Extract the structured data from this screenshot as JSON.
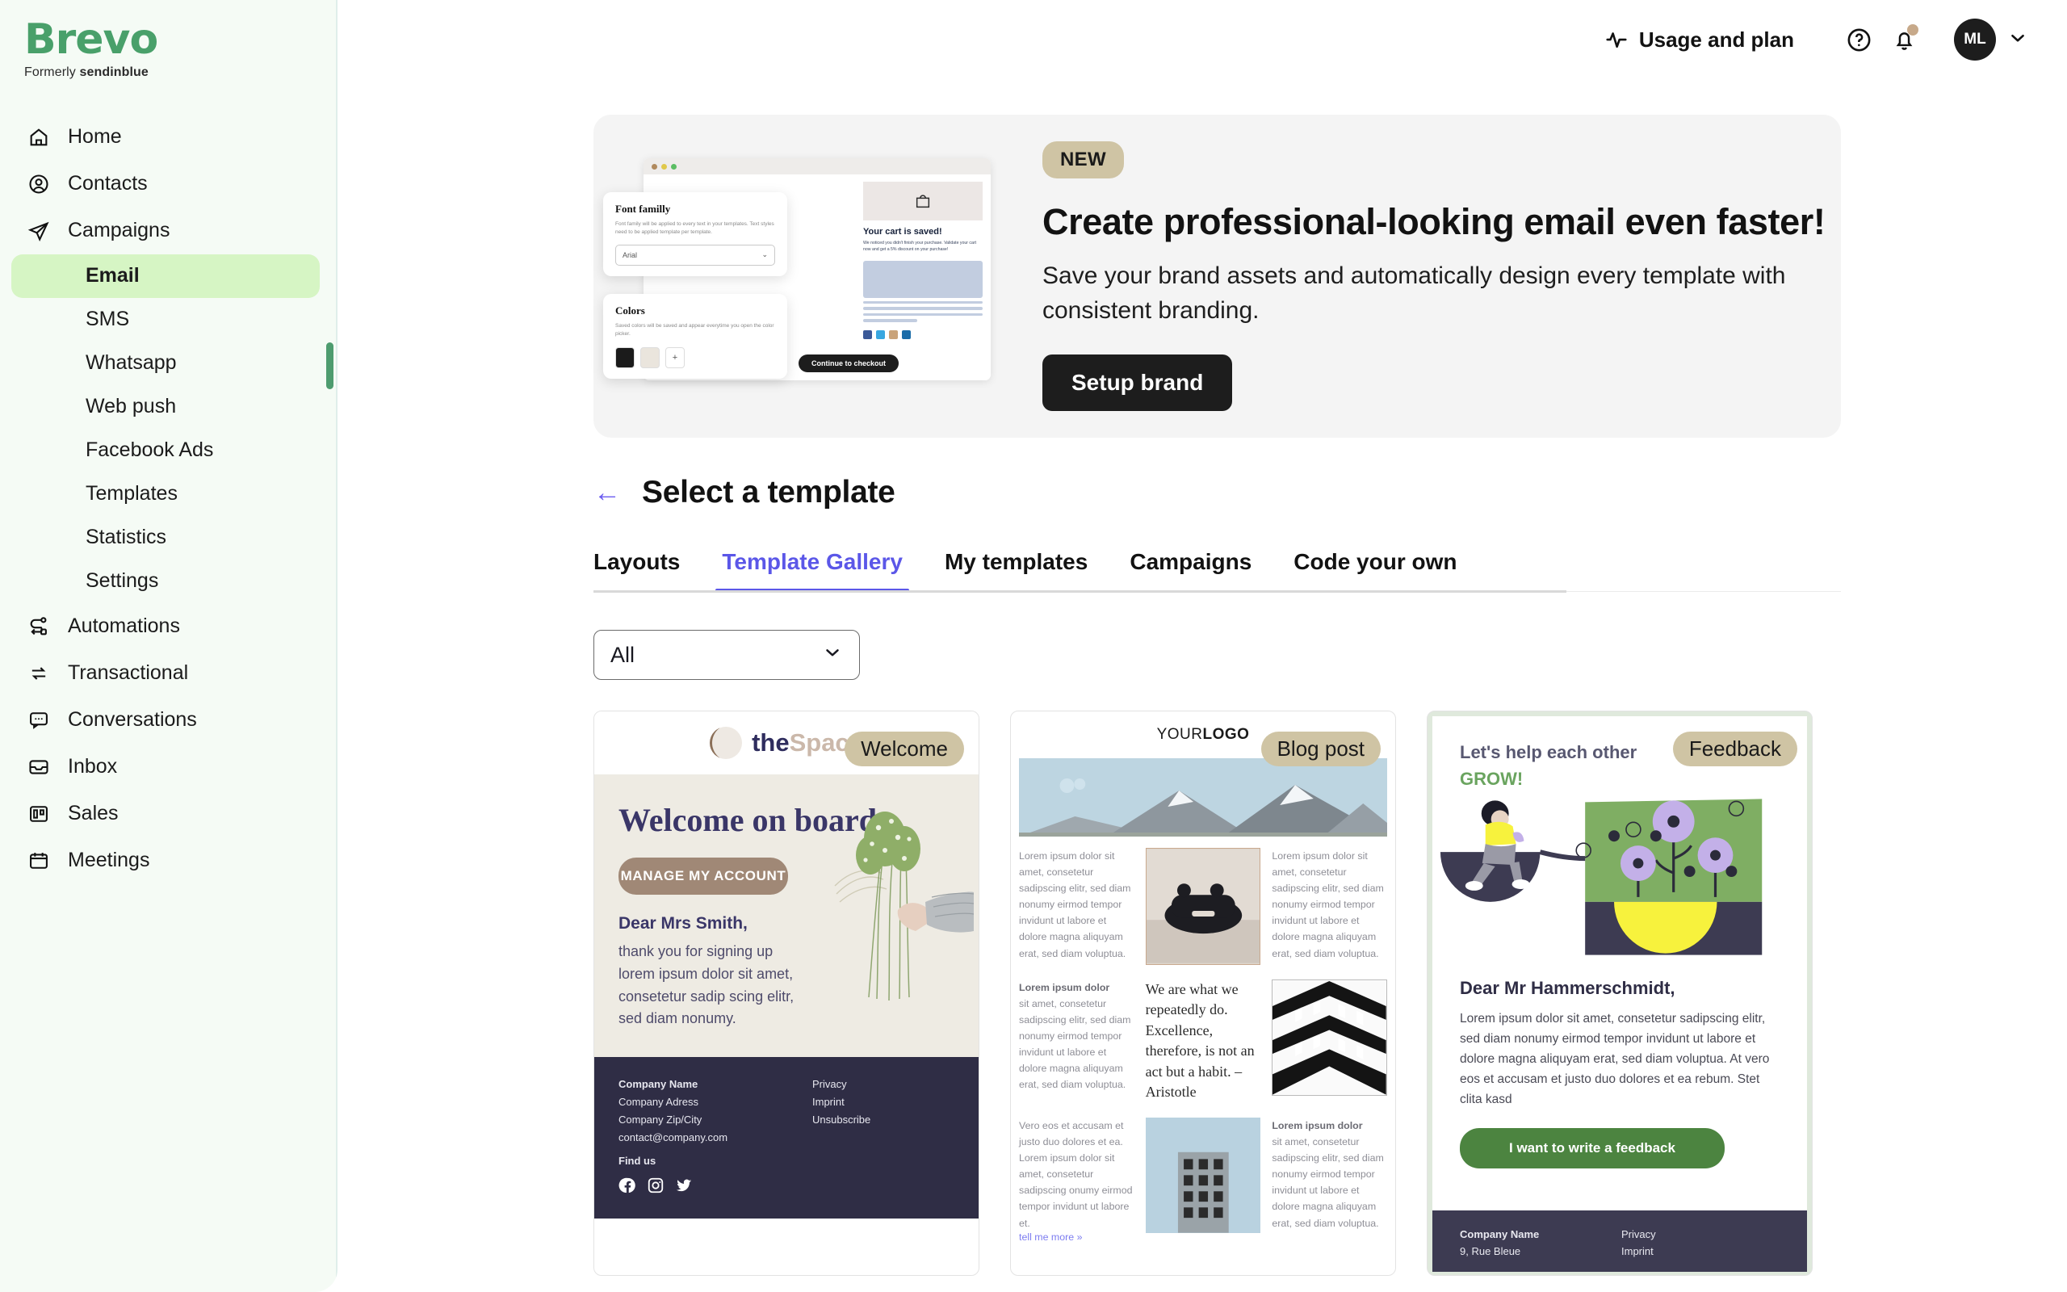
{
  "brand": {
    "name": "Brevo",
    "tagline_prefix": "Formerly",
    "tagline_bold": "sendinblue"
  },
  "sidebar": {
    "items": [
      {
        "label": "Home",
        "icon": "home-icon"
      },
      {
        "label": "Contacts",
        "icon": "user-circle-icon"
      },
      {
        "label": "Campaigns",
        "icon": "paper-plane-icon"
      }
    ],
    "subitems": [
      {
        "label": "Email",
        "active": true
      },
      {
        "label": "SMS",
        "active": false
      },
      {
        "label": "Whatsapp",
        "active": false
      },
      {
        "label": "Web push",
        "active": false
      },
      {
        "label": "Facebook Ads",
        "active": false
      },
      {
        "label": "Templates",
        "active": false
      },
      {
        "label": "Statistics",
        "active": false
      },
      {
        "label": "Settings",
        "active": false
      }
    ],
    "items2": [
      {
        "label": "Automations",
        "icon": "automation-icon"
      },
      {
        "label": "Transactional",
        "icon": "exchange-icon"
      },
      {
        "label": "Conversations",
        "icon": "chat-icon"
      },
      {
        "label": "Inbox",
        "icon": "inbox-icon"
      },
      {
        "label": "Sales",
        "icon": "kanban-icon"
      },
      {
        "label": "Meetings",
        "icon": "calendar-icon"
      }
    ]
  },
  "topbar": {
    "usage_label": "Usage and plan",
    "help_icon": "question-circle-icon",
    "notifications_icon": "bell-icon",
    "avatar_initials": "ML",
    "caret_icon": "chevron-down-icon"
  },
  "promo": {
    "badge": "NEW",
    "heading": "Create professional-looking email even faster!",
    "body": "Save your brand assets and automatically design every template with consistent branding.",
    "cta": "Setup brand",
    "mock": {
      "font_card_title": "Font familly",
      "font_card_body": "Font family will be applied to every text in your templates. Text styles need to be applied template per template.",
      "font_select_value": "Arial",
      "colors_card_title": "Colors",
      "colors_card_body": "Saved colors will be saved and appear everytime you open the color picker.",
      "add_color": "+",
      "email_title": "Your cart is saved!",
      "email_body": "We noticed you didn't finish your purchase. Validate your cart now and get a 5% discount on your purchase!",
      "email_cta": "Continue to checkout"
    }
  },
  "page": {
    "back_icon": "arrow-left-icon",
    "title": "Select a template"
  },
  "tabs": [
    {
      "label": "Layouts",
      "active": false
    },
    {
      "label": "Template Gallery",
      "active": true
    },
    {
      "label": "My templates",
      "active": false
    },
    {
      "label": "Campaigns",
      "active": false
    },
    {
      "label": "Code your own",
      "active": false
    }
  ],
  "filter": {
    "value": "All",
    "chevron": "chevron-down-icon"
  },
  "templates": [
    {
      "badge": "Welcome",
      "logo_dark": "the",
      "logo_light": "Space",
      "heading": "Welcome on board",
      "button": "MANAGE MY ACCOUNT",
      "salutation": "Dear Mrs Smith,",
      "body": "thank you for signing up lorem ipsum dolor sit amet, consetetur sadip scing elitr, sed diam nonumy.",
      "footer": {
        "company": "Company Name",
        "address": "Company Adress",
        "zip": "Company Zip/City",
        "email": "contact@company.com",
        "find_us": "Find us",
        "links": [
          "Privacy",
          "Imprint",
          "Unsubscribe"
        ]
      }
    },
    {
      "badge": "Blog post",
      "logo_light": "YOUR",
      "logo_dark": "LOGO",
      "col1_text": "Lorem ipsum dolor sit amet, consetetur sadipscing elitr, sed diam nonumy eirmod tempor invidunt ut labore et dolore magna aliquyam erat, sed diam voluptua.",
      "col3_text": "Lorem ipsum dolor sit amet, consetetur sadipscing elitr, sed diam nonumy eirmod tempor invidunt ut labore et dolore magna aliquyam erat, sed diam voluptua.",
      "row2_col1_bold": "Lorem ipsum dolor",
      "row2_col1_text": "sit amet, consetetur sadipscing elitr, sed diam nonumy eirmod tempor invidunt ut labore et dolore magna aliquyam erat, sed diam voluptua.",
      "quote": "We are what we repeatedly do. Excellence, therefore, is not an act but a habit. – Aristotle",
      "row3_col1_text": "Vero eos et accusam et justo duo dolores et ea. Lorem ipsum dolor sit amet, consetetur sadipscing onumy eirmod tempor invidunt ut labore et.",
      "row3_link": "tell me more »",
      "row3_col3_bold": "Lorem ipsum dolor",
      "row3_col3_text": "sit amet, consetetur sadipscing elitr, sed diam nonumy eirmod tempor invidunt ut labore et dolore magna aliquyam erat, sed diam voluptua."
    },
    {
      "badge": "Feedback",
      "heading_line1": "Let's help each other",
      "heading_line2": "GROW!",
      "salutation": "Dear Mr Hammerschmidt,",
      "body": "Lorem ipsum dolor sit amet, consetetur sadipscing elitr, sed diam nonumy eirmod tempor invidunt ut labore et dolore magna aliquyam erat, sed diam voluptua. At vero eos et accusam et justo duo dolores et ea rebum. Stet clita kasd",
      "button": "I want to write a feedback",
      "footer": {
        "company": "Company Name",
        "address": "9, Rue Bleue",
        "links": [
          "Privacy",
          "Imprint"
        ]
      }
    }
  ]
}
